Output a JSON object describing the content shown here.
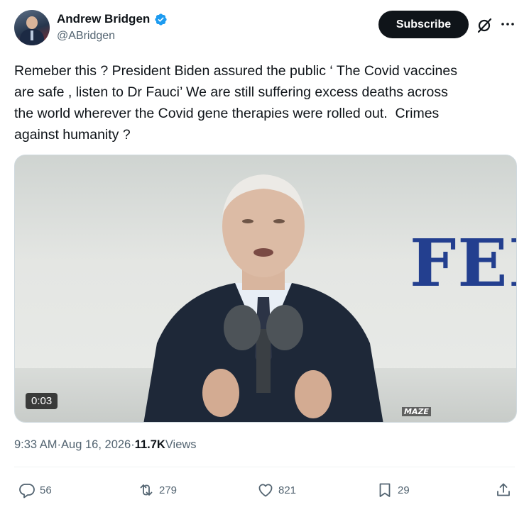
{
  "author": {
    "display_name": "Andrew Bridgen",
    "handle": "@ABridgen",
    "verified": true
  },
  "header": {
    "subscribe_label": "Subscribe"
  },
  "tweet": {
    "text": "Remeber this ? President Biden assured the public ‘ The Covid vaccines\nare safe , listen to Dr Fauci’ We are still suffering excess deaths across\nthe world wherever the Covid gene therapies were rolled out.  Crimes\nagainst humanity ?"
  },
  "media": {
    "video_time": "0:03",
    "background_sign_text": "FEM",
    "watermark": "MAZE"
  },
  "meta": {
    "time": "9:33 AM",
    "separator": " · ",
    "date": "Aug 16, 2026",
    "views_count": "11.7K",
    "views_label": " Views"
  },
  "actions": {
    "replies": "56",
    "reposts": "279",
    "likes": "821",
    "bookmarks": "29"
  },
  "colors": {
    "verified": "#1d9bf0",
    "text_primary": "#0f1419",
    "text_secondary": "#536471",
    "subscribe_bg": "#0f1419"
  },
  "icons": {
    "verified": "verified-badge-icon",
    "grok": "grok-icon",
    "more": "more-dots-icon",
    "reply": "reply-icon",
    "repost": "repost-icon",
    "like": "heart-icon",
    "bookmark": "bookmark-icon",
    "share": "share-icon"
  }
}
